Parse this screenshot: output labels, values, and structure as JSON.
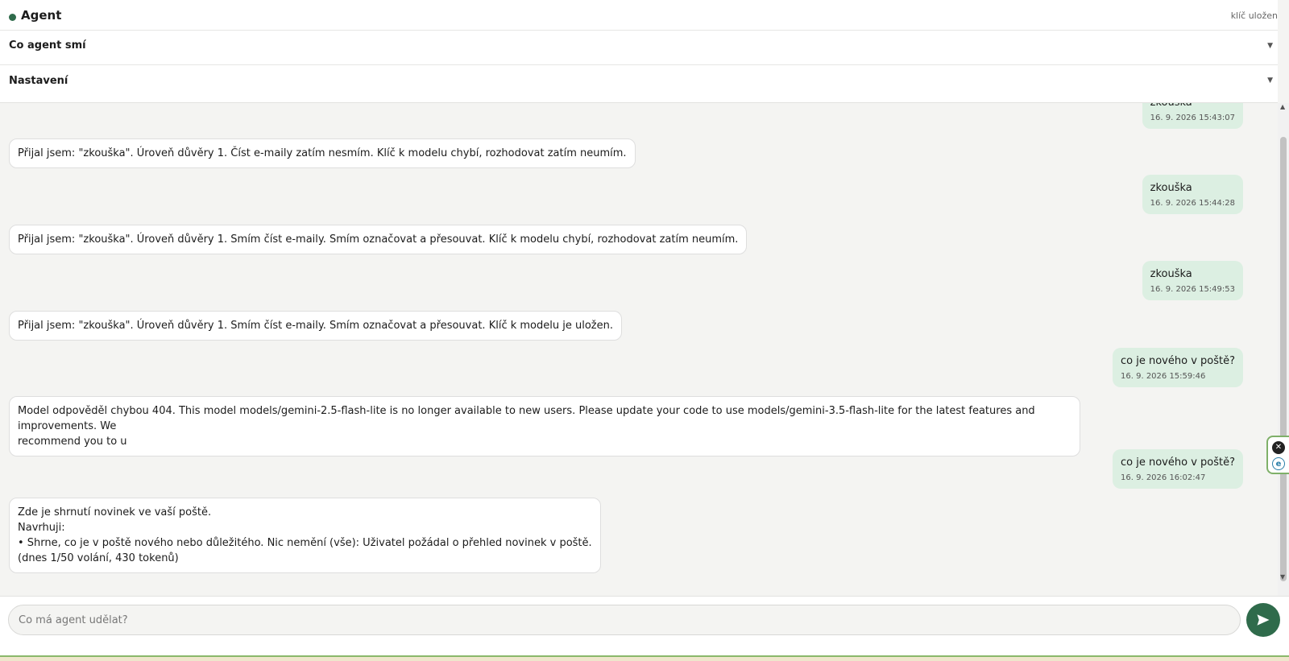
{
  "header": {
    "title": "Agent",
    "key_status": "klíč uložen",
    "sections": {
      "permissions": "Co agent smí",
      "settings": "Nastavení"
    }
  },
  "messages": [
    {
      "role": "user",
      "text": "zkouška",
      "time": "16. 9. 2026 15:43:07"
    },
    {
      "role": "agent",
      "lines": [
        "Přijal jsem: \"zkouška\". Úroveň důvěry 1. Číst e-maily zatím nesmím. Klíč k modelu chybí, rozhodovat zatím neumím."
      ]
    },
    {
      "role": "user",
      "text": "zkouška",
      "time": "16. 9. 2026 15:44:28"
    },
    {
      "role": "agent",
      "lines": [
        "Přijal jsem: \"zkouška\". Úroveň důvěry 1. Smím číst e-maily. Smím označovat a přesouvat. Klíč k modelu chybí, rozhodovat zatím neumím."
      ]
    },
    {
      "role": "user",
      "text": "zkouška",
      "time": "16. 9. 2026 15:49:53"
    },
    {
      "role": "agent",
      "lines": [
        "Přijal jsem: \"zkouška\". Úroveň důvěry 1. Smím číst e-maily. Smím označovat a přesouvat. Klíč k modelu je uložen."
      ]
    },
    {
      "role": "user",
      "text": "co je nového v poště?",
      "time": "16. 9. 2026 15:59:46"
    },
    {
      "role": "agent",
      "lines": [
        "Model odpověděl chybou 404. This model models/gemini-2.5-flash-lite is no longer available to new users. Please update your code to use models/gemini-3.5-flash-lite for the latest features and improvements. We",
        "recommend you to u"
      ]
    },
    {
      "role": "user",
      "text": "co je nového v poště?",
      "time": "16. 9. 2026 16:02:47"
    },
    {
      "role": "agent",
      "lines": [
        "Zde je shrnutí novinek ve vaší poště.",
        "Navrhuji:",
        "• Shrne, co je v poště nového nebo důležitého. Nic nemění (vše): Uživatel požádal o přehled novinek v poště.",
        "(dnes 1/50 volání, 430 tokenů)"
      ]
    }
  ],
  "composer": {
    "placeholder": "Co má agent udělat?",
    "value": ""
  },
  "float_widget": {
    "close_glyph": "✕",
    "e_glyph": "e"
  },
  "colors": {
    "accent": "#2f6b4b",
    "user_bubble": "#dcefe2",
    "agent_bubble": "#ffffff"
  }
}
